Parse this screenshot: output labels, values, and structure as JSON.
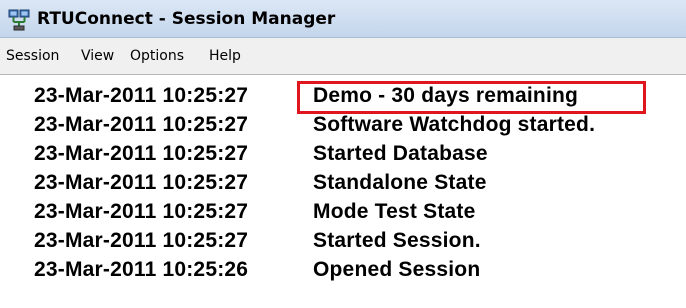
{
  "window": {
    "title": "RTUConnect - Session Manager",
    "icon": "network-icon"
  },
  "menu": {
    "items": [
      {
        "label": "Session"
      },
      {
        "label": "View"
      },
      {
        "label": "Options"
      },
      {
        "label": "Help"
      }
    ]
  },
  "log": {
    "entries": [
      {
        "timestamp": "23-Mar-2011 10:25:27",
        "message": "Demo - 30 days remaining",
        "highlighted": true
      },
      {
        "timestamp": "23-Mar-2011 10:25:27",
        "message": "Software Watchdog started."
      },
      {
        "timestamp": "23-Mar-2011 10:25:27",
        "message": "Started Database"
      },
      {
        "timestamp": "23-Mar-2011 10:25:27",
        "message": "Standalone State"
      },
      {
        "timestamp": "23-Mar-2011 10:25:27",
        "message": "Mode Test State"
      },
      {
        "timestamp": "23-Mar-2011 10:25:27",
        "message": "Started Session."
      },
      {
        "timestamp": "23-Mar-2011 10:25:26",
        "message": "Opened Session"
      }
    ]
  },
  "colors": {
    "highlight_border": "#e0161e",
    "titlebar": "#c4d6ec",
    "menubar": "#f0f0f0"
  }
}
